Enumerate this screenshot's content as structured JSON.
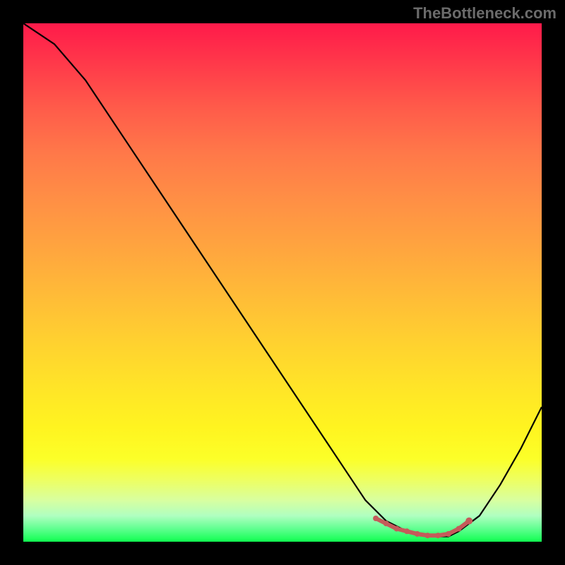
{
  "watermark": "TheBottleneck.com",
  "chart_data": {
    "type": "line",
    "title": "",
    "xlabel": "",
    "ylabel": "",
    "xlim": [
      0,
      100
    ],
    "ylim": [
      0,
      100
    ],
    "grid": false,
    "legend": false,
    "background_gradient": {
      "direction": "vertical",
      "stops": [
        {
          "pos": 0,
          "color": "#ff1a4a"
        },
        {
          "pos": 50,
          "color": "#ffba38"
        },
        {
          "pos": 80,
          "color": "#fcff28"
        },
        {
          "pos": 100,
          "color": "#10ff50"
        }
      ]
    },
    "series": [
      {
        "name": "bottleneck-curve",
        "x": [
          0,
          6,
          12,
          20,
          30,
          40,
          50,
          60,
          66,
          70,
          74,
          78,
          82,
          84,
          88,
          92,
          96,
          100
        ],
        "values": [
          100,
          96,
          89,
          77,
          62,
          47,
          32,
          17,
          8,
          4,
          2,
          1,
          1,
          2,
          5,
          11,
          18,
          26
        ]
      }
    ],
    "highlight_region": {
      "name": "optimal-zone",
      "x_start": 68,
      "x_end": 84,
      "dots_x": [
        68,
        70,
        72,
        74,
        76,
        78,
        80,
        82,
        84,
        86
      ],
      "dots_y": [
        4.5,
        3.5,
        2.5,
        2,
        1.5,
        1.2,
        1.2,
        1.5,
        2.5,
        4
      ]
    }
  }
}
